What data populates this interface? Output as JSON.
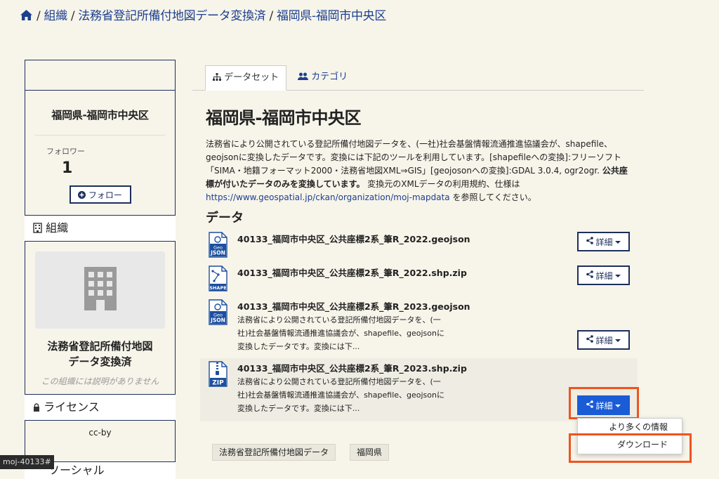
{
  "breadcrumb": {
    "home_icon": "home-icon",
    "items": [
      "組織",
      "法務省登記所備付地図データ変換済",
      "福岡県-福岡市中央区"
    ]
  },
  "sidebar": {
    "package_title": "福岡県-福岡市中央区",
    "followers_label": "フォロワー",
    "followers_count": "1",
    "follow_button": "フォロー",
    "org_section": "組織",
    "org_name_line1": "法務省登記所備付地図",
    "org_name_line2": "データ変換済",
    "org_description": "この組織には説明がありません",
    "license_section": "ライセンス",
    "license_value": "cc-by",
    "social_section": "ソーシャル"
  },
  "status_bar": "moj-40133#",
  "tabs": [
    {
      "label": "データセット",
      "icon": "sitemap-icon"
    },
    {
      "label": "カテゴリ",
      "icon": "users-icon"
    }
  ],
  "dataset": {
    "title": "福岡県-福岡市中央区",
    "description_1": "法務省により公開されている登記所備付地図データを、(一社)社会基盤情報流通推進協議会が、shapefile、geojsonに変換したデータです。変換には下記のツールを利用しています。[shapefileへの変換]:フリーソフト「SIMA・地籍フォーマット2000・法務省地図XML⇒GIS」[geojosonへの変換]:GDAL 3.0.4, ogr2ogr. ",
    "description_bold": "公共座標が付いたデータのみを変換しています。",
    "description_2": " 変換元のXMLデータの利用規約、仕様は ",
    "description_link": "https://www.geospatial.jp/ckan/organization/moj-mapdata",
    "description_3": " を参照してください。"
  },
  "data_heading": "データ",
  "resources": [
    {
      "name": "40133_福岡市中央区_公共座標2系_筆R_2022.geojson",
      "format": "JSON",
      "icon": "geojson-file-icon",
      "desc": ""
    },
    {
      "name": "40133_福岡市中央区_公共座標2系_筆R_2022.shp.zip",
      "format": "SHAPE",
      "icon": "shape-file-icon",
      "desc": ""
    },
    {
      "name": "40133_福岡市中央区_公共座標2系_筆R_2023.geojson",
      "format": "JSON",
      "icon": "geojson-file-icon",
      "desc": "法務省により公開されている登記所備付地図データを、(一社)社会基盤情報流通推進協議会が、shapefile、geojsonに変換したデータです。変換には下..."
    },
    {
      "name": "40133_福岡市中央区_公共座標2系_筆R_2023.shp.zip",
      "format": "ZIP",
      "icon": "zip-file-icon",
      "desc": "法務省により公開されている登記所備付地図データを、(一社)社会基盤情報流通推進協議会が、shapefile、geojsonに変換したデータです。変換には下..."
    }
  ],
  "detail_button": "詳細",
  "dropdown": {
    "more_info": "より多くの情報",
    "download": "ダウンロード"
  },
  "tags": [
    "法務省登記所備付地図データ",
    "福岡県"
  ],
  "colors": {
    "primary": "#1a5bd6",
    "navy": "#1c2f5c",
    "highlight": "#f0531f",
    "background": "#f7f4ea"
  }
}
